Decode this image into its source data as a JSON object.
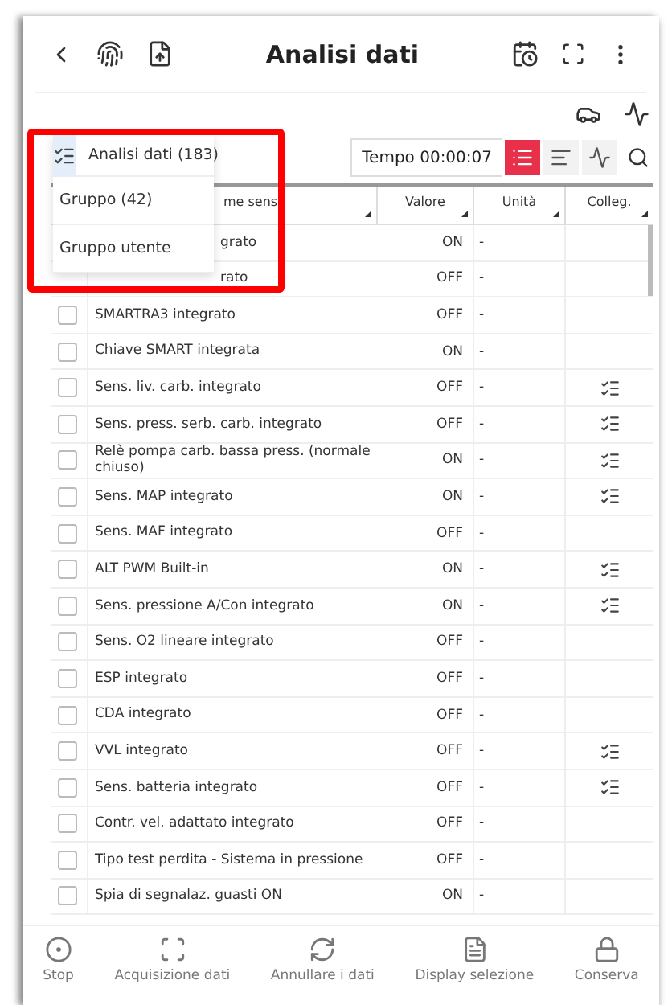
{
  "header": {
    "title": "Analisi dati"
  },
  "menu": {
    "items": [
      {
        "label": "Analisi dati (183)",
        "selected": true
      },
      {
        "label": "Gruppo (42)",
        "selected": false
      },
      {
        "label": "Gruppo utente",
        "selected": false
      }
    ]
  },
  "toolbar": {
    "timer": "Tempo 00:00:07",
    "views": [
      {
        "kind": "list",
        "selected": true
      },
      {
        "kind": "text",
        "selected": false
      },
      {
        "kind": "graph",
        "selected": false
      }
    ]
  },
  "table": {
    "columns": [
      "me sens",
      "Valore",
      "Unità",
      "Colleg."
    ],
    "rows_under_menu": [
      {
        "name": "grato",
        "value": "ON",
        "unit": "-"
      },
      {
        "name": "rato",
        "value": "OFF",
        "unit": "-"
      }
    ],
    "rows": [
      {
        "name": "SMARTRA3 integrato",
        "value": "OFF",
        "unit": "-",
        "checked": false,
        "linked": false
      },
      {
        "name": "Chiave SMART integrata",
        "value": "ON",
        "unit": "-",
        "checked": false,
        "linked": false
      },
      {
        "name": "Sens. liv. carb. integrato",
        "value": "OFF",
        "unit": "-",
        "checked": false,
        "linked": true
      },
      {
        "name": "Sens. press. serb. carb. integrato",
        "value": "OFF",
        "unit": "-",
        "checked": false,
        "linked": true
      },
      {
        "name": "Relè pompa carb. bassa press. (normale chiuso)",
        "value": "ON",
        "unit": "-",
        "checked": false,
        "linked": true
      },
      {
        "name": "Sens. MAP integrato",
        "value": "ON",
        "unit": "-",
        "checked": false,
        "linked": true
      },
      {
        "name": "Sens. MAF integrato",
        "value": "OFF",
        "unit": "-",
        "checked": false,
        "linked": false
      },
      {
        "name": "ALT PWM Built-in",
        "value": "ON",
        "unit": "-",
        "checked": false,
        "linked": true
      },
      {
        "name": "Sens. pressione A/Con integrato",
        "value": "ON",
        "unit": "-",
        "checked": false,
        "linked": true
      },
      {
        "name": "Sens. O2 lineare integrato",
        "value": "OFF",
        "unit": "-",
        "checked": false,
        "linked": false
      },
      {
        "name": "ESP integrato",
        "value": "OFF",
        "unit": "-",
        "checked": false,
        "linked": false
      },
      {
        "name": "CDA integrato",
        "value": "OFF",
        "unit": "-",
        "checked": false,
        "linked": false
      },
      {
        "name": "VVL integrato",
        "value": "OFF",
        "unit": "-",
        "checked": false,
        "linked": true
      },
      {
        "name": "Sens. batteria integrato",
        "value": "OFF",
        "unit": "-",
        "checked": false,
        "linked": true
      },
      {
        "name": "Contr. vel. adattato integrato",
        "value": "OFF",
        "unit": "-",
        "checked": false,
        "linked": false
      },
      {
        "name": "Tipo test perdita - Sistema in pressione",
        "value": "OFF",
        "unit": "-",
        "checked": false,
        "linked": false
      },
      {
        "name": "Spia di segnalaz. guasti ON",
        "value": "ON",
        "unit": "-",
        "checked": false,
        "linked": false
      }
    ]
  },
  "bottom_bar": [
    {
      "kind": "stop",
      "label": "Stop"
    },
    {
      "kind": "capture",
      "label": "Acquisizione dati"
    },
    {
      "kind": "reset",
      "label": "Annullare i dati"
    },
    {
      "kind": "display",
      "label": "Display selezione"
    },
    {
      "kind": "keep",
      "label": "Conserva"
    }
  ]
}
